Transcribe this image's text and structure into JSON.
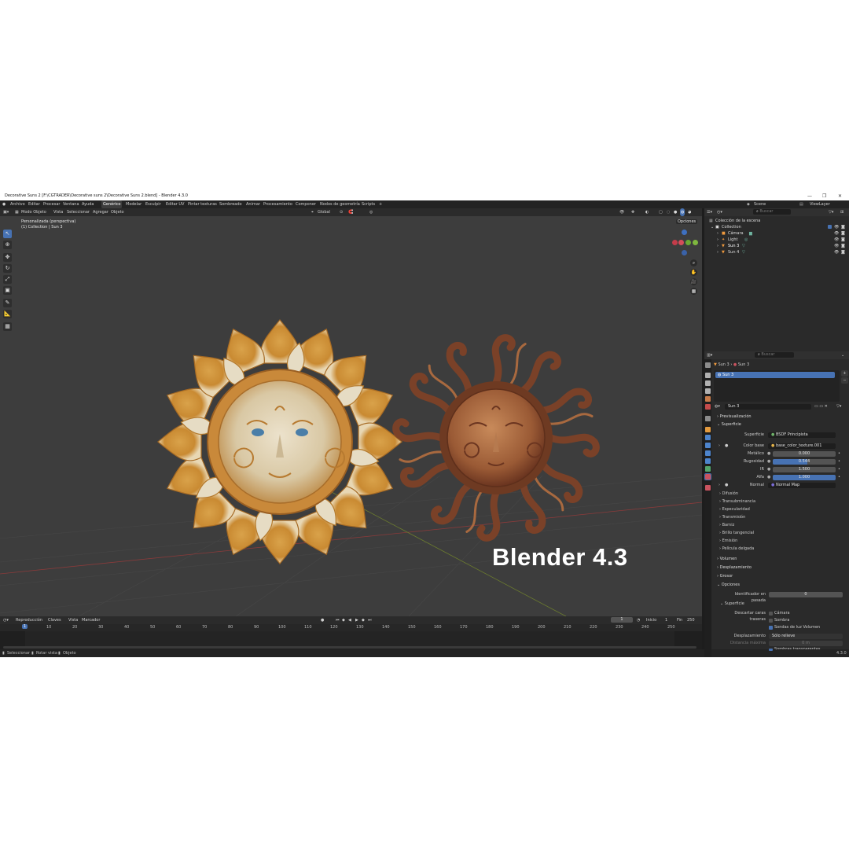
{
  "window": {
    "title": "Decorative Suns 2 [F:\\CGTRADER\\Decorative suns 2\\Decorative Suns 2.blend] - Blender 4.3.0",
    "min": "—",
    "max": "❐",
    "close": "✕"
  },
  "menu": {
    "items": [
      "Archivo",
      "Editar",
      "Procesar",
      "Ventana",
      "Ayuda"
    ],
    "workspaces": [
      "Genérico",
      "Modelar",
      "Esculpir",
      "Editar UV",
      "Pintar texturas",
      "Sombreado",
      "Animar",
      "Procesamiento",
      "Componer",
      "Nodos de geometría",
      "Scripts"
    ],
    "add": "+",
    "scene": "Scene",
    "view_layer": "ViewLayer"
  },
  "viewport_header": {
    "mode": "Modo Objeto",
    "items": [
      "Vista",
      "Seleccionar",
      "Agregar",
      "Objeto"
    ],
    "orientation": "Global",
    "options": "Opciones"
  },
  "viewport": {
    "view_name": "Personalizada (perspectiva)",
    "collection_info": "(1) Collection | Sun 3",
    "overlay_text": "Blender 4.3"
  },
  "timeline": {
    "menu": [
      "Reproducción",
      "Claves",
      "Vista",
      "Marcador"
    ],
    "current_frame": "1",
    "start_label": "Inicio",
    "start": "1",
    "end_label": "Fin",
    "end": "250",
    "ruler": [
      "1",
      "10",
      "20",
      "30",
      "40",
      "50",
      "60",
      "70",
      "80",
      "90",
      "100",
      "110",
      "120",
      "130",
      "140",
      "150",
      "160",
      "170",
      "180",
      "190",
      "200",
      "210",
      "220",
      "230",
      "240",
      "250"
    ]
  },
  "statusbar": {
    "items": [
      "Seleccionar",
      "Rotar vista",
      "Objeto"
    ],
    "version": "4.3.0"
  },
  "outliner": {
    "search_placeholder": "Buscar",
    "root": "Colección de la escena",
    "collection": "Collection",
    "objects": [
      "Cámara",
      "Light",
      "Sun 3",
      "Sun 4"
    ]
  },
  "properties": {
    "search_placeholder": "Buscar",
    "breadcrumb": [
      "Sun 3",
      "Sun 3"
    ],
    "material_slot": "Sun 3",
    "material_name": "Sun 3",
    "sections": {
      "preview": "Previsualización",
      "surface": "Superficie",
      "volume": "Volumen",
      "displacement": "Desplazamiento",
      "thickness": "Grosor",
      "options": "Opciones",
      "options_surface": "Superficie"
    },
    "surface_label": "Superficie",
    "surface_value": "BSDF Principista",
    "rows": [
      {
        "label": "Color base",
        "value": "base_color_texture.001"
      },
      {
        "label": "Metálico",
        "value": "0.000"
      },
      {
        "label": "Rugosidad",
        "value": "0.544"
      },
      {
        "label": "IR",
        "value": "1.500"
      },
      {
        "label": "Alfa",
        "value": "1.000"
      },
      {
        "label": "Normal",
        "value": "Normal Map"
      }
    ],
    "roughness_fraction": 0.544,
    "subpanels": [
      "Difusión",
      "Transubminancia",
      "Especularidad",
      "Transmisión",
      "Barniz",
      "Brillo tangencial",
      "Emisión",
      "Película delgada"
    ],
    "pass_index_label": "Identificador en pasada",
    "pass_index": "0",
    "backface_label": "Descartar caras traseras",
    "backface_options": [
      "Cámara",
      "Sombra",
      "Sondas de luz Volumen"
    ],
    "displacement_label": "Desplazamiento",
    "displacement_value": "Sólo relieve",
    "max_distance_label": "Distancia máxima",
    "max_distance": "0 m",
    "transparent_shadows": "Sombras transparentes"
  },
  "colors": {
    "accent": "#4772b3",
    "viewport_bg": "#3d3d3d",
    "panel_bg": "#2a2a2a",
    "sun_gold": "#d7a043",
    "sun_bronze": "#8c5234"
  }
}
